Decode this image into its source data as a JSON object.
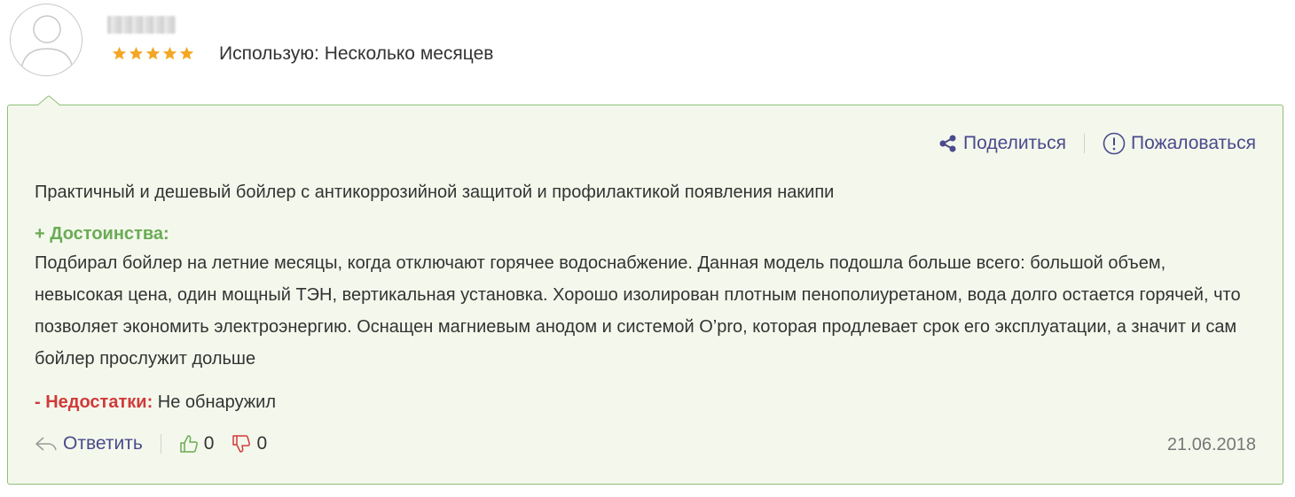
{
  "author": {
    "avatar_icon": "user-silhouette-icon",
    "rating": 5,
    "usage_label": "Использую:",
    "usage_value": "Несколько месяцев"
  },
  "actions": {
    "share_icon": "share-icon",
    "share_label": "Поделиться",
    "report_icon": "exclamation-circle-icon",
    "report_label": "Пожаловаться"
  },
  "review": {
    "summary": "Практичный и дешевый бойлер с антикоррозийной защитой и профилактикой появления накипи",
    "pros_title": "+ Достоинства:",
    "pros_text": "Подбирал бойлер на летние месяцы, когда отключают горячее водоснабжение. Данная модель подошла больше всего: большой объем, невысокая цена, один мощный ТЭН, вертикальная установка. Хорошо изолирован плотным пенополиуретаном, вода долго остается горячей, что позволяет экономить электроэнергию. Оснащен магниевым анодом и системой O’pro, которая продлевает срок его эксплуатации, а значит и сам бойлер прослужит дольше",
    "cons_title": "- Недостатки:",
    "cons_text": "Не обнаружил"
  },
  "footer": {
    "reply_icon": "reply-arrow-icon",
    "reply_label": "Ответить",
    "likes": "0",
    "dislikes": "0",
    "date": "21.06.2018"
  },
  "colors": {
    "card_bg": "#f4f8ec",
    "card_border": "#8ec07a",
    "link": "#4a4a8c",
    "pros": "#6aab55",
    "cons": "#d03a3a",
    "star": "#f5a623"
  }
}
